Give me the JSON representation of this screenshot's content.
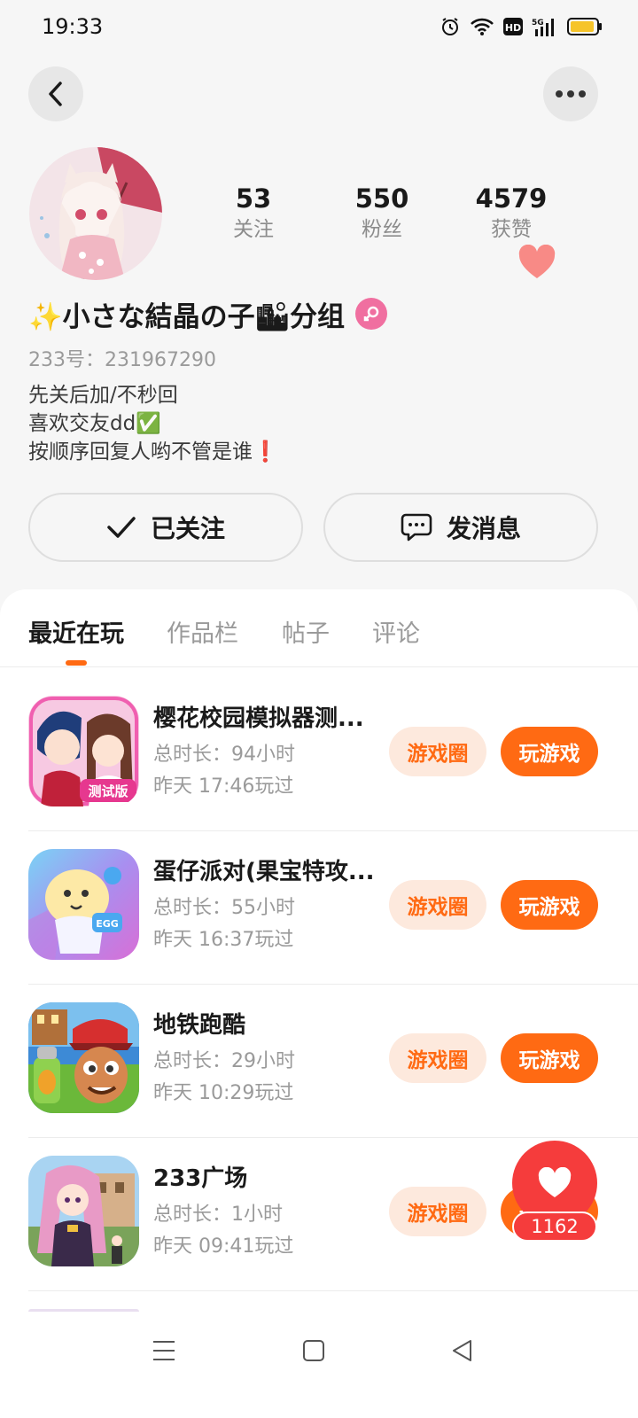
{
  "status_bar": {
    "time": "19:33"
  },
  "profile": {
    "stats": [
      {
        "value": "53",
        "label": "关注"
      },
      {
        "value": "550",
        "label": "粉丝"
      },
      {
        "value": "4579",
        "label": "获赞"
      }
    ],
    "nickname": "✨小さな結晶の子🏙分组",
    "uid": "233号：231967290",
    "bio_lines": [
      "先关后加/不秒回",
      "喜欢交友dd✅",
      "按顺序回复人哟不管是谁❗"
    ]
  },
  "actions": {
    "followed_label": "已关注",
    "message_label": "发消息"
  },
  "tabs": [
    "最近在玩",
    "作品栏",
    "帖子",
    "评论"
  ],
  "games": [
    {
      "name": "樱花校园模拟器测...",
      "duration": "总时长：94小时",
      "last_played": "昨天 17:46玩过",
      "circle_label": "游戏圈",
      "play_label": "玩游戏"
    },
    {
      "name": "蛋仔派对(果宝特攻...",
      "duration": "总时长：55小时",
      "last_played": "昨天 16:37玩过",
      "circle_label": "游戏圈",
      "play_label": "玩游戏"
    },
    {
      "name": "地铁跑酷",
      "duration": "总时长：29小时",
      "last_played": "昨天 10:29玩过",
      "circle_label": "游戏圈",
      "play_label": "玩游戏"
    },
    {
      "name": "233广场",
      "duration": "总时长：1小时",
      "last_played": "昨天 09:41玩过",
      "circle_label": "游戏圈",
      "play_label": "玩游戏"
    }
  ],
  "like_fab": {
    "count": "1162"
  },
  "colors": {
    "accent": "#ff6a13",
    "accent_light": "#fde9dd",
    "like_red": "#f53c3c",
    "page_bg": "#f6f6f6"
  }
}
